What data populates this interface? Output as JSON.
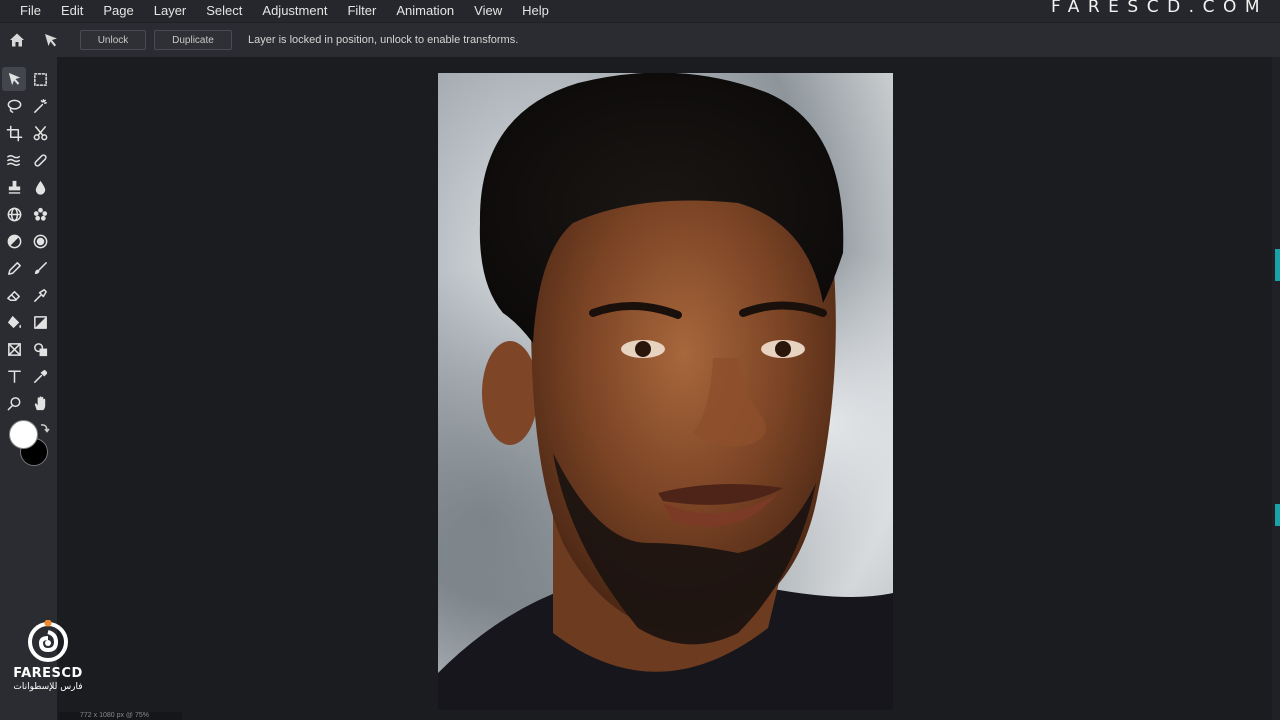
{
  "menu": {
    "items": [
      "File",
      "Edit",
      "Page",
      "Layer",
      "Select",
      "Adjustment",
      "Filter",
      "Animation",
      "View",
      "Help"
    ]
  },
  "brand": "FARESCD.COM",
  "options": {
    "unlock_label": "Unlock",
    "duplicate_label": "Duplicate",
    "message": "Layer is locked in position, unlock to enable transforms."
  },
  "colors": {
    "foreground": "#ffffff",
    "background": "#000000",
    "accent": "#19a3a8"
  },
  "tools": [
    [
      "move-icon",
      "marquee-icon"
    ],
    [
      "lasso-icon",
      "magic-wand-icon"
    ],
    [
      "crop-icon",
      "cut-icon"
    ],
    [
      "liquify-icon",
      "healing-icon"
    ],
    [
      "stamp-icon",
      "blur-drop-icon"
    ],
    [
      "globe-icon",
      "flower-icon"
    ],
    [
      "dodge-icon",
      "sponge-icon"
    ],
    [
      "pencil-icon",
      "brush-icon"
    ],
    [
      "eraser-icon",
      "spray-icon"
    ],
    [
      "fill-bucket-icon",
      "gradient-icon"
    ],
    [
      "transform-icon",
      "shape-icon"
    ],
    [
      "text-icon",
      "eyedropper-icon"
    ],
    [
      "zoom-icon",
      "hand-icon"
    ]
  ],
  "status": {
    "text": "772 x 1080 px @ 75%"
  },
  "watermark": {
    "name": "FARESCD",
    "subtitle": "فارس للإسطوانات"
  }
}
